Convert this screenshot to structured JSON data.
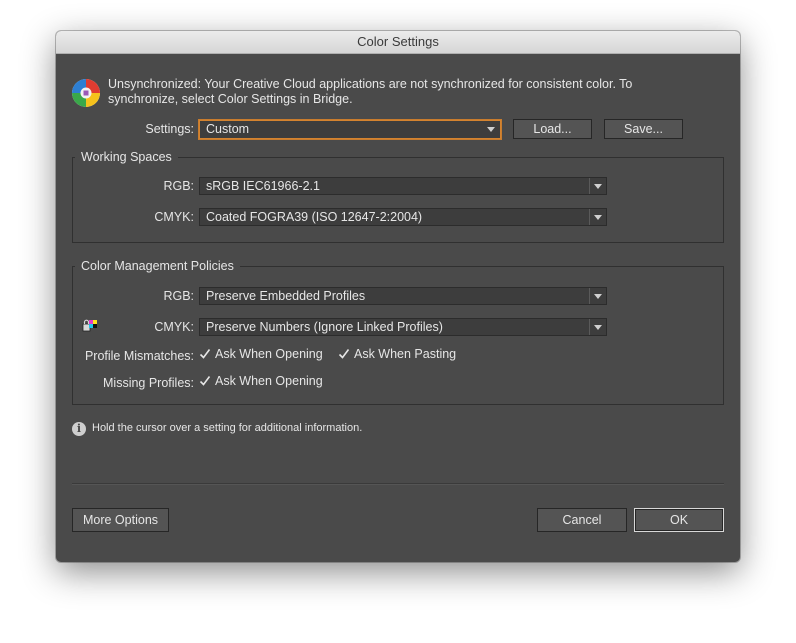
{
  "window": {
    "title": "Color Settings"
  },
  "sync": {
    "message_line1": "Unsynchronized: Your Creative Cloud applications are not synchronized for consistent color. To",
    "message_line2": "synchronize, select Color Settings in Bridge.",
    "icon": "color-sync-wheel-icon"
  },
  "settings": {
    "label": "Settings:",
    "value": "Custom",
    "load_label": "Load...",
    "save_label": "Save..."
  },
  "working_spaces": {
    "title": "Working Spaces",
    "rgb_label": "RGB:",
    "rgb_value": "sRGB IEC61966-2.1",
    "cmyk_label": "CMYK:",
    "cmyk_value": "Coated FOGRA39 (ISO 12647-2:2004)"
  },
  "policies": {
    "title": "Color Management Policies",
    "rgb_label": "RGB:",
    "rgb_value": "Preserve Embedded Profiles",
    "cmyk_label": "CMYK:",
    "cmyk_value": "Preserve Numbers (Ignore Linked Profiles)",
    "cmyk_icon": "lock-color-icon",
    "mismatch_label": "Profile Mismatches:",
    "mismatch_opening_label": "Ask When Opening",
    "mismatch_opening_checked": true,
    "mismatch_pasting_label": "Ask When Pasting",
    "mismatch_pasting_checked": true,
    "missing_label": "Missing Profiles:",
    "missing_opening_label": "Ask When Opening",
    "missing_opening_checked": true
  },
  "info": {
    "icon": "info-icon",
    "text": "Hold the cursor over a setting for additional information."
  },
  "footer": {
    "more_options_label": "More Options",
    "cancel_label": "Cancel",
    "ok_label": "OK"
  },
  "colors": {
    "dialog_bg": "#4a4a4a",
    "focus_ring": "#d4832f",
    "text": "#e6e6e6"
  }
}
